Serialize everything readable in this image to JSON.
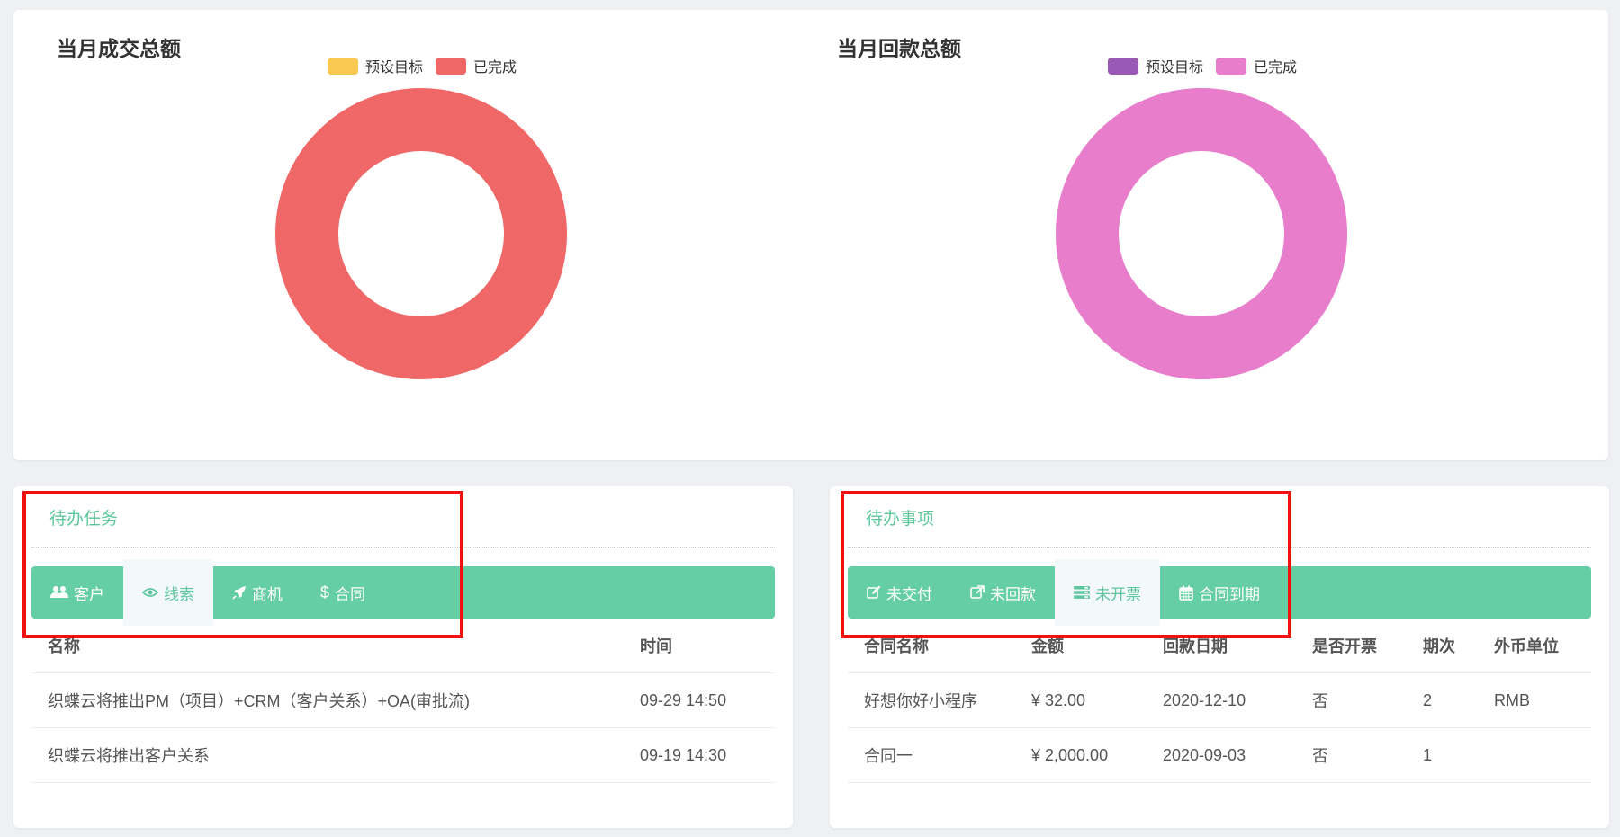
{
  "sales_chart": {
    "title": "当月成交总额",
    "legend": [
      {
        "label": "预设目标",
        "color": "#f9c851"
      },
      {
        "label": "已完成",
        "color": "#ef6767"
      }
    ],
    "chart_data": {
      "type": "pie",
      "donut": true,
      "categories": [
        "预设目标",
        "已完成"
      ],
      "values": [
        0,
        100
      ]
    }
  },
  "payment_chart": {
    "title": "当月回款总额",
    "legend": [
      {
        "label": "预设目标",
        "color": "#9b59b6"
      },
      {
        "label": "已完成",
        "color": "#e87dcb"
      }
    ],
    "chart_data": {
      "type": "pie",
      "donut": true,
      "categories": [
        "预设目标",
        "已完成"
      ],
      "values": [
        0,
        100
      ]
    }
  },
  "todo_tasks": {
    "title": "待办任务",
    "tabs": [
      {
        "label": "客户",
        "icon": "users-icon",
        "active": false
      },
      {
        "label": "线索",
        "icon": "eye-icon",
        "active": true
      },
      {
        "label": "商机",
        "icon": "rocket-icon",
        "active": false
      },
      {
        "label": "合同",
        "icon": "dollar-icon",
        "active": false
      }
    ],
    "columns": [
      "名称",
      "时间"
    ],
    "rows": [
      [
        "织蝶云将推出PM（项目）+CRM（客户关系）+OA(审批流)",
        "09-29 14:50"
      ],
      [
        "织蝶云将推出客户关系",
        "09-19 14:30"
      ]
    ]
  },
  "todo_items": {
    "title": "待办事项",
    "tabs": [
      {
        "label": "未交付",
        "icon": "edit-icon",
        "active": false
      },
      {
        "label": "未回款",
        "icon": "external-link-icon",
        "active": false
      },
      {
        "label": "未开票",
        "icon": "list-icon",
        "active": true
      },
      {
        "label": "合同到期",
        "icon": "calendar-icon",
        "active": false
      }
    ],
    "columns": [
      "合同名称",
      "金额",
      "回款日期",
      "是否开票",
      "期次",
      "外币单位"
    ],
    "rows": [
      [
        "好想你好小程序",
        "¥ 32.00",
        "2020-12-10",
        "否",
        "2",
        "RMB"
      ],
      [
        "合同一",
        "¥ 2,000.00",
        "2020-09-03",
        "否",
        "1",
        ""
      ]
    ]
  },
  "colors": {
    "accent": "#66cea5",
    "accent_text": "#5ec69c",
    "highlight_box": "#f01010"
  }
}
